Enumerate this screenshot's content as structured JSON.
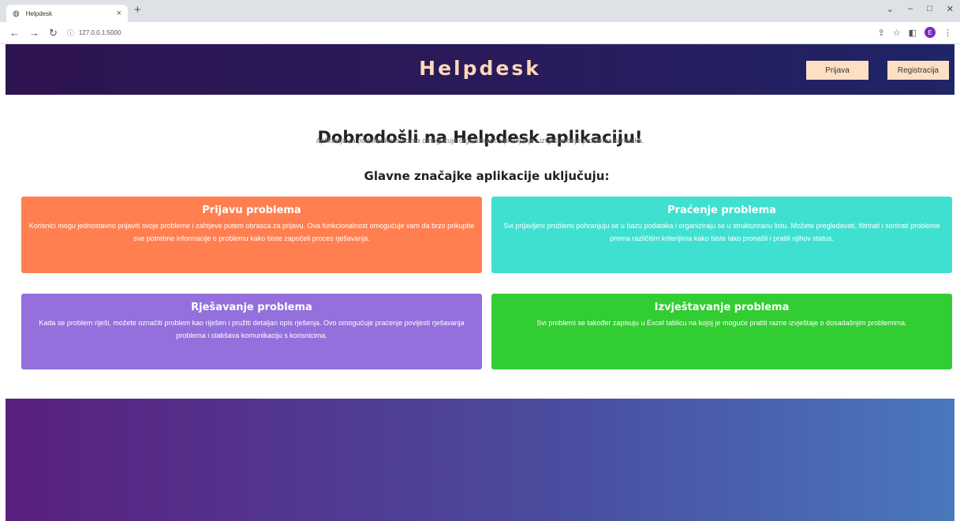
{
  "browser": {
    "tab_title": "Helpdesk",
    "tab_favicon": "globe-icon",
    "new_tab_label": "+",
    "url": "127.0.0.1:5000",
    "profile_initial": "E",
    "window_controls": [
      "⌄",
      "–",
      "□",
      "✕"
    ]
  },
  "header": {
    "title": "Helpdesk",
    "login_label": "Prijava",
    "register_label": "Registracija",
    "gradient_colors": [
      "#2e1450",
      "#1f2566"
    ],
    "button_color": "#fde0c4",
    "title_color": "#fcd8b8"
  },
  "intro": {
    "title": "Dobrodošli na Helpdesk aplikaciju!",
    "subtitle": "Aplikacija za podršku korisnicima omogućuje organizirano upravljanje i izvještavanje problema korisnika."
  },
  "features": {
    "title": "Glavne značajke aplikacije uključuju:",
    "items": [
      {
        "title": "Prijavu problema",
        "text": "Korisnici mogu jednostavno prijaviti svoje probleme i zahtjeve putem obrasca za prijavu. Ova funkcionalnost omogućuje vam da brzo prikupite sve potrebne informacije o problemu kako biste započeli proces rješavanja.",
        "color": "#ff7f50"
      },
      {
        "title": "Praćenje problema",
        "text": "Svi prijavljeni problemi pohranjuju se u bazu podataka i organiziraju se u strukturiranu listu. Možete pregledavati, filtrirati i sortirati probleme prema različitim kriterijima kako biste lako pronašli i pratili njihov status.",
        "color": "#40e0d0"
      },
      {
        "title": "Rješavanje problema",
        "text": "Kada se problem riješi, možete označiti problem kao riješen i pružiti detaljan opis rješenja. Ovo omogućuje praćenje povijesti rješavanja problema i olakšava komunikaciju s korisnicima.",
        "color": "#9370db"
      },
      {
        "title": "Izvještavanje problema",
        "text": "Svi problemi se također zapisuju u Excel tablicu na kojoj je moguće pratiti razne izvještaje o dosadašnjim problemima.",
        "color": "#32cd32"
      }
    ]
  },
  "footer": {
    "gradient_colors": [
      "#5a1f80",
      "#4a78bd"
    ]
  }
}
